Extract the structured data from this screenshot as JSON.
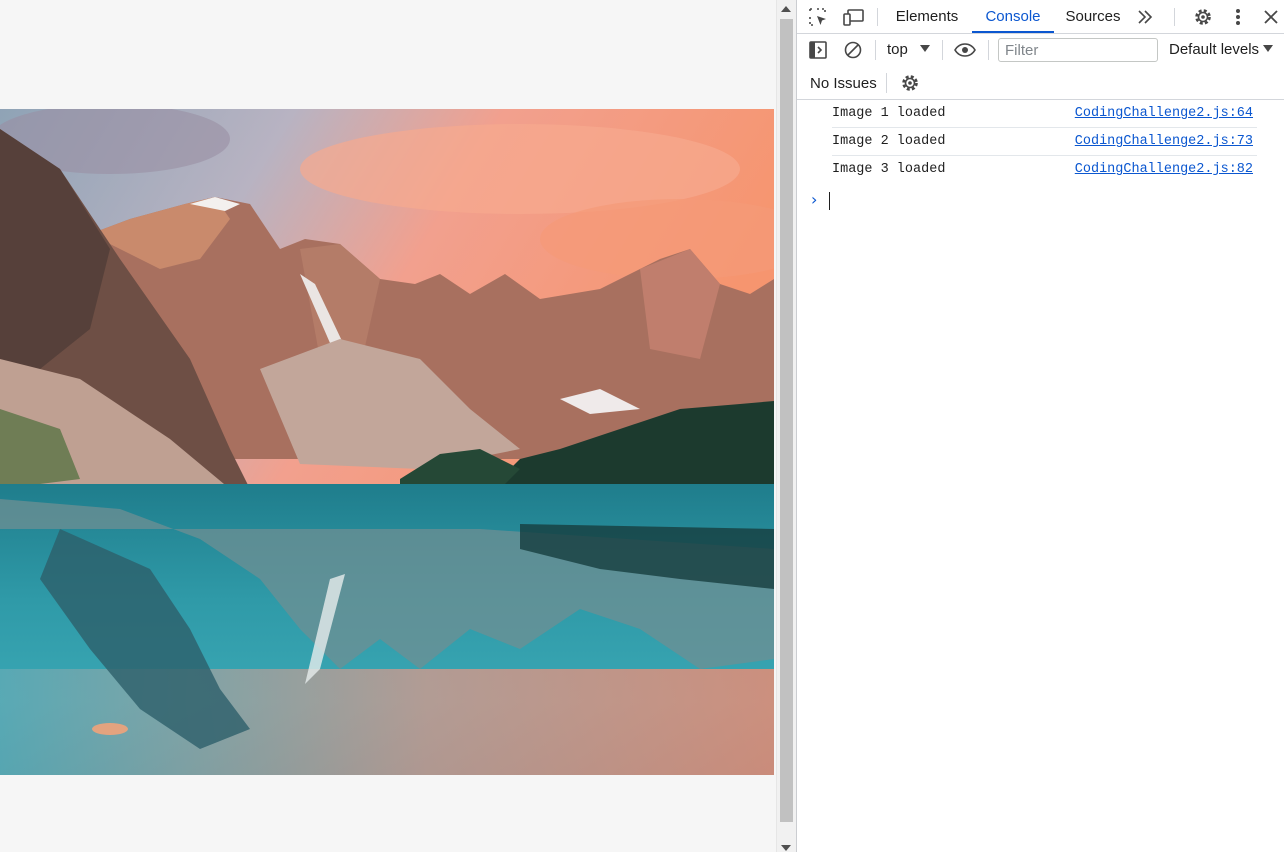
{
  "devtools": {
    "tabs": [
      {
        "label": "Elements",
        "active": false
      },
      {
        "label": "Console",
        "active": true
      },
      {
        "label": "Sources",
        "active": false
      }
    ],
    "more_tabs_icon": "double-chevron-right-icon",
    "toolbar": {
      "context": "top",
      "filter_placeholder": "Filter",
      "levels": "Default levels"
    },
    "issues": "No Issues",
    "messages": [
      {
        "text": "Image 1 loaded",
        "source": "CodingChallenge2.js:64"
      },
      {
        "text": "Image 2 loaded",
        "source": "CodingChallenge2.js:73"
      },
      {
        "text": "Image 3 loaded",
        "source": "CodingChallenge2.js:82"
      }
    ],
    "accent_color": "#0b57d0"
  },
  "page": {
    "image_subject": "mountain-lake-landscape"
  }
}
